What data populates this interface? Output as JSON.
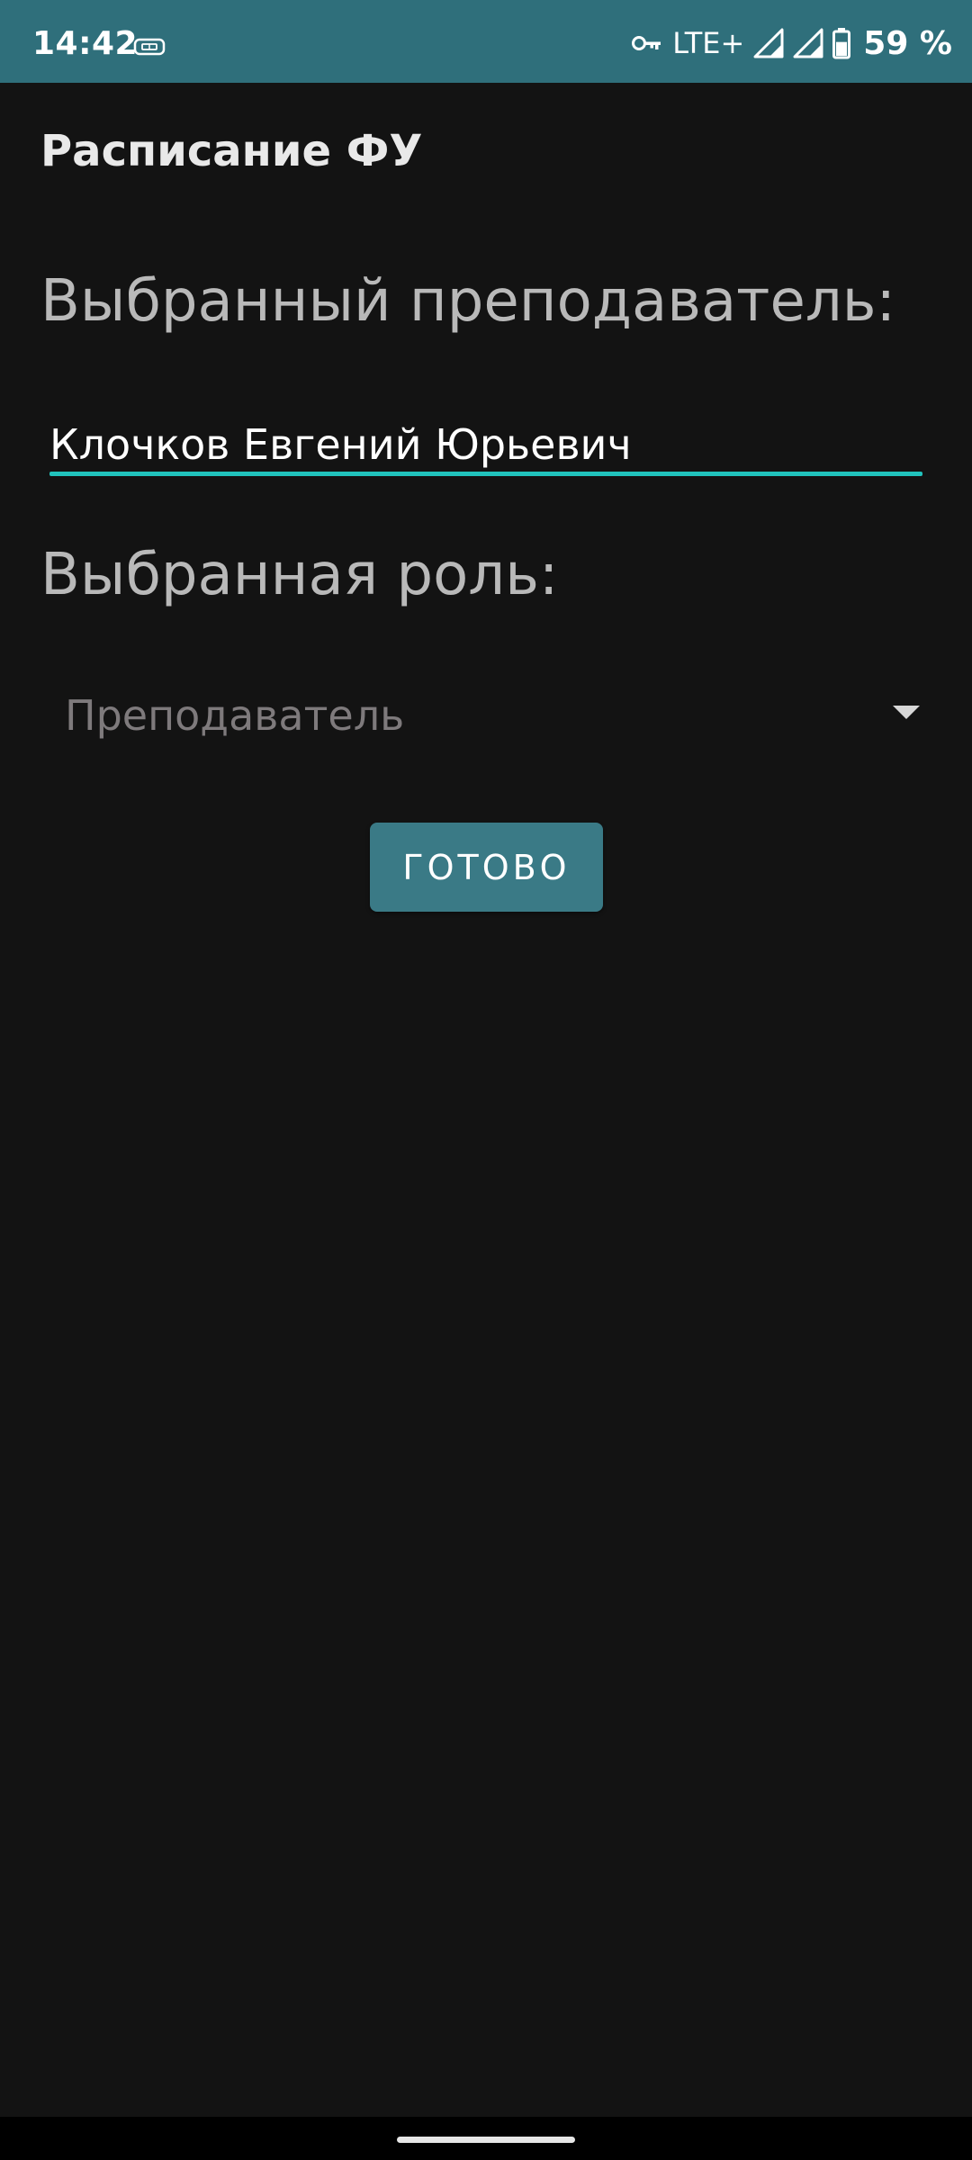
{
  "status_bar": {
    "time": "14:42",
    "network": "LTE+",
    "battery_percent": "59 %",
    "battery_level": 0.59,
    "background_color": "#2f6f7b",
    "icons": [
      "sim-icon",
      "vpn-key-icon",
      "signal-icon",
      "signal-icon",
      "battery-icon"
    ]
  },
  "app": {
    "title": "Расписание ФУ"
  },
  "form": {
    "teacher_label": "Выбранный преподаватель:",
    "teacher_value": "Клочков Евгений Юрьевич",
    "role_label": "Выбранная роль:",
    "role_selected": "Преподаватель",
    "done_button": "ГОТОВО",
    "accent_color": "#21c3bd",
    "button_color": "#3a7a86"
  }
}
